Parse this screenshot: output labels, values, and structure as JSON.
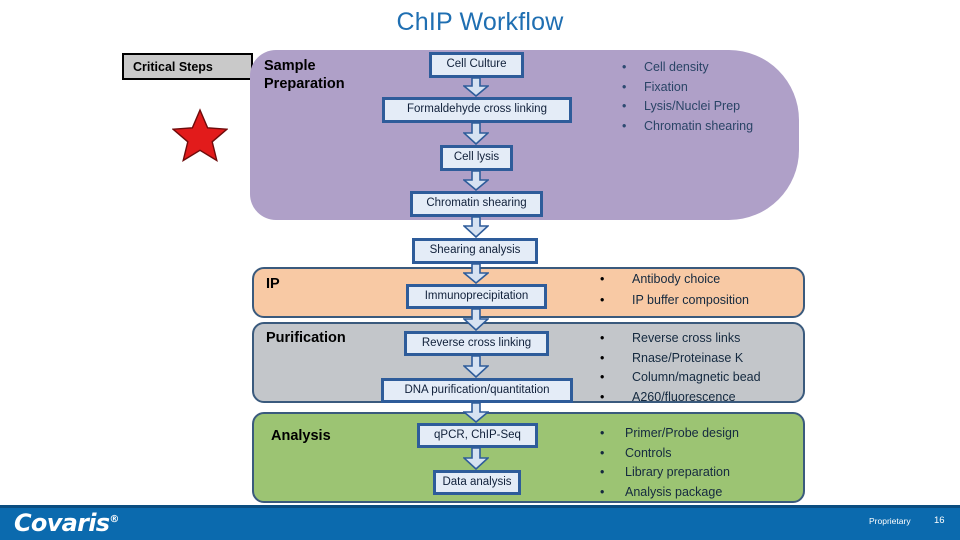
{
  "slide": {
    "title": "ChIP Workflow"
  },
  "legend": {
    "critical_steps_label": "Critical Steps",
    "star_icon": "red-star-icon",
    "star_color": "#E21B1B"
  },
  "stages": [
    {
      "id": "sample-preparation",
      "label": "Sample\nPreparation",
      "color": "#AFA0C8",
      "steps": [
        "Cell Culture",
        "Formaldehyde cross linking",
        "Cell lysis",
        "Chromatin shearing"
      ],
      "bullets": [
        "Cell density",
        "Fixation",
        "Lysis/Nuclei Prep",
        "Chromatin shearing"
      ]
    },
    {
      "id": "ip",
      "label": "IP",
      "color": "#F8C9A4",
      "steps": [
        "Immunoprecipitation"
      ],
      "bullets": [
        "Antibody choice",
        "IP buffer composition"
      ]
    },
    {
      "id": "purification",
      "label": "Purification",
      "color": "#C3C6CA",
      "steps": [
        "Reverse cross linking",
        "DNA purification/quantitation"
      ],
      "bullets": [
        "Reverse cross links",
        "Rnase/Proteinase K",
        "Column/magnetic bead",
        "A260/fluorescence"
      ]
    },
    {
      "id": "analysis",
      "label": "Analysis",
      "color": "#9CC473",
      "steps": [
        "qPCR, ChIP-Seq",
        "Data analysis"
      ],
      "bullets": [
        "Primer/Probe design",
        "Controls",
        "Library preparation",
        "Analysis package"
      ]
    }
  ],
  "flow": {
    "boxes": {
      "cell_culture": "Cell Culture",
      "formaldehyde": "Formaldehyde cross linking",
      "cell_lysis": "Cell lysis",
      "chromatin_shearing": "Chromatin shearing",
      "shearing_analysis": "Shearing analysis",
      "immunoprecipitation": "Immunoprecipitation",
      "reverse_cross_linking": "Reverse cross linking",
      "dna_purification": "DNA purification/quantitation",
      "qpcr_chipseq": "qPCR, ChIP-Seq",
      "data_analysis": "Data analysis"
    },
    "box_fill": "#E4ECF7",
    "box_border": "#2E5C9A",
    "arrow_icon": "down-block-arrow-icon"
  },
  "stage_labels": {
    "sample_prep_line1": "Sample",
    "sample_prep_line2": "Preparation",
    "ip": "IP",
    "purification": "Purification",
    "analysis": "Analysis"
  },
  "bullets": {
    "prep": [
      "Cell density",
      "Fixation",
      "Lysis/Nuclei Prep",
      "Chromatin shearing"
    ],
    "ip": [
      "Antibody choice",
      "IP buffer composition"
    ],
    "purification": [
      "Reverse cross links",
      "Rnase/Proteinase K",
      "Column/magnetic bead",
      "A260/fluorescence"
    ],
    "analysis": [
      "Primer/Probe design",
      "Controls",
      "Library preparation",
      "Analysis package"
    ],
    "marker": "•"
  },
  "footer": {
    "logo_text": "Covaris",
    "logo_tm": "®",
    "proprietary": "Proprietary",
    "page_number": "16",
    "bar_color": "#0B6AAE"
  }
}
